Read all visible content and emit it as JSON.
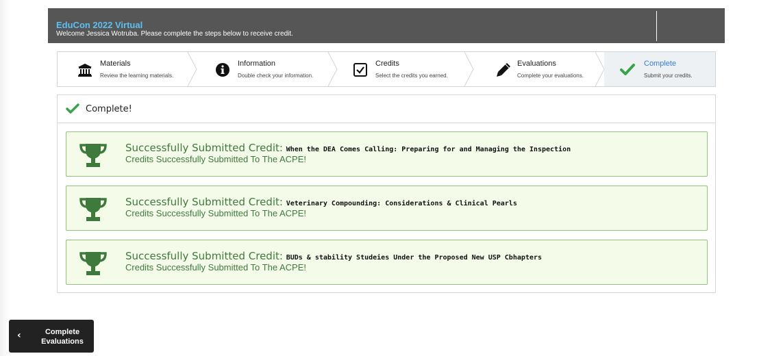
{
  "header": {
    "title": "EduCon 2022 Virtual",
    "welcome": "Welcome Jessica Wotruba. Please complete the steps below to receive credit."
  },
  "steps": [
    {
      "name": "Materials",
      "desc": "Review the learning materials.",
      "icon": "bank-icon"
    },
    {
      "name": "Information",
      "desc": "Double check your information.",
      "icon": "info-icon"
    },
    {
      "name": "Credits",
      "desc": "Select the credits you earned.",
      "icon": "checkbox-icon"
    },
    {
      "name": "Evaluations",
      "desc": "Complete your evaluations.",
      "icon": "pencil-icon"
    },
    {
      "name": "Complete",
      "desc": "Submit your credits.",
      "icon": "checkmark-icon",
      "active": true
    }
  ],
  "panel": {
    "title": "Complete!"
  },
  "credits": [
    {
      "prefix": "Successfully Submitted Credit: ",
      "course": "When the DEA Comes Calling: Preparing for and Managing the Inspection",
      "status": "Credits Successfully Submitted To The ACPE!"
    },
    {
      "prefix": "Successfully Submitted Credit: ",
      "course": "Veterinary Compounding: Considerations & Clinical Pearls",
      "status": "Credits Successfully Submitted To The ACPE!"
    },
    {
      "prefix": "Successfully Submitted Credit: ",
      "course": "BUDs & stability Studeies Under the Proposed New USP Cbhapters",
      "status": "Credits Successfully Submitted To The ACPE!"
    }
  ],
  "back_button": {
    "arrow": "‹",
    "label_line1": "Complete",
    "label_line2": "Evaluations"
  },
  "colors": {
    "header_bg": "#565656",
    "title": "#5bc0f2",
    "success_green": "#3e7a3c",
    "card_bg": "#f5fbe9",
    "active_step": "#3b7bd1"
  }
}
